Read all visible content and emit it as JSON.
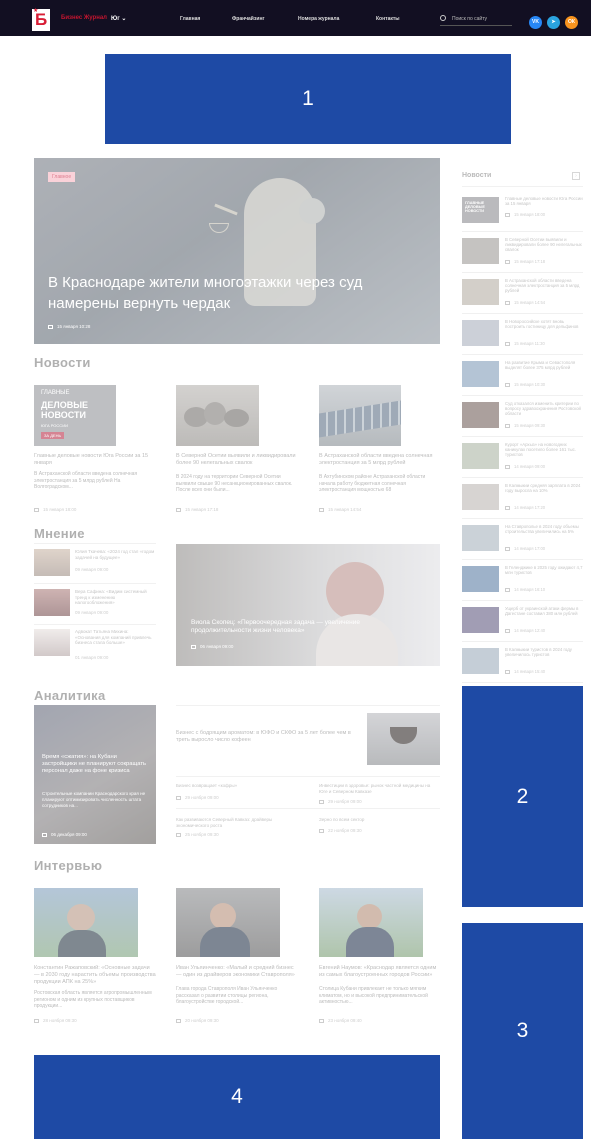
{
  "header": {
    "logo_letter": "Б",
    "brand": "Бизнес Журнал",
    "region": "Юг",
    "nav": [
      "Главная",
      "Франчайзинг",
      "Номера журнала",
      "Контакты"
    ],
    "search_placeholder": "Поиск по сайту",
    "social": [
      "vk-icon",
      "telegram-icon",
      "odnoklassniki-icon"
    ]
  },
  "ads": [
    "1",
    "2",
    "3",
    "4"
  ],
  "hero": {
    "tag": "Главное",
    "title": "В Краснодаре жители многоэтажки через суд намерены вернуть чердак",
    "date": "15 января 10:28"
  },
  "news": {
    "title": "Новости",
    "items": [
      {
        "title": "Главные деловые новости Юга России за 15 января",
        "text": "В Астраханской области введена солнечная электростанция за 5 млрд рублей На Волгоградском...",
        "date": "15 января 18:00",
        "image": {
          "line1": "ГЛАВНЫЕ",
          "line2": "ДЕЛОВЫЕ",
          "line3": "НОВОСТИ",
          "line4": "ЮГА РОССИИ",
          "line5": "ЗА ДЕНЬ"
        }
      },
      {
        "title": "В Северной Осетии выявили и ликвидировали более 90 нелегальных свалок",
        "text": "В 2024 году на территории Северной Осетии выявили свыше 90 несанкционированных свалок. После всех они были...",
        "date": "15 января 17:18"
      },
      {
        "title": "В Астраханской области введена солнечная электростанция за 5 млрд рублей",
        "text": "В Ахтубинском районе Астраханской области начала работу бюджетная солнечная электростанция мощностью 68",
        "date": "15 января 14:54"
      }
    ]
  },
  "opinion": {
    "title": "Мнение",
    "items": [
      {
        "text": "Юлия Ткачева: «2024 год стал «годом задачей на будущее»",
        "date": "09 января 09:00"
      },
      {
        "text": "Вера Сафина: «Видим системный тренд к изменению налогообложения»",
        "date": "09 января 09:00"
      },
      {
        "text": "Адвокат Татьяна Михина: «Основания для компаний привлечь бизнеса стала больше»",
        "date": "01 января 09:00"
      }
    ],
    "feature": {
      "title": "Виола Скопец: «Первоочередная задача — увеличение продолжительности жизни человека»",
      "date": "06 января 09:00"
    }
  },
  "analytics": {
    "title": "Аналитика",
    "feature": {
      "title": "Время «сжатия»: на Кубани застройщики не планируют сокращать персонал даже на фоне кризиса",
      "text": "Строительные компании Краснодарского края не планируют оптимизировать численность штата сотрудников на...",
      "date": "06 декабря 09:00"
    },
    "main": {
      "title": "Бизнес с бодрящим ароматом: в ЮФО и СКФО за 5 лет более чем в треть выросло число кофеен"
    },
    "items": [
      {
        "title": "Бизнес возвращает «кофры»",
        "date": "29 ноября 09:00"
      },
      {
        "title": "Инвестиции в здоровье: рынок частной медицины на Юге и Северном Кавказе",
        "date": "29 ноября 09:00"
      },
      {
        "title": "Как развиваются Северный Кавказ: драйверы экономического роста",
        "date": "25 ноября 09:30"
      },
      {
        "title": "Зерно по всем сектор",
        "date": "22 ноября 09:30"
      }
    ]
  },
  "interviews": {
    "title": "Интервью",
    "items": [
      {
        "title": "Константин Ражаповский: «Основные задачи — в 2030 году нарастить объемы производства продукции АПК на 25%»",
        "text": "Ростовская область является агропромышленным регионом и одним из крупных поставщиков продукции...",
        "date": "28 ноября 09:30"
      },
      {
        "title": "Иван Ульяинченко: «Малый и средний бизнес — один из драйверов экономики Ставрополя»",
        "text": "Глава города Ставрополя Иван Ульянченко рассказал о развитии столицы региона, благоустройстве городской...",
        "date": "20 ноября 09:30"
      },
      {
        "title": "Евгений Наумов: «Краснодар является одним из самых благоустроенных городов России»",
        "text": "Столица Кубани привлекает не только мягким климатом, но и высокой предпринимательской активностью...",
        "date": "23 ноября 09:40"
      }
    ]
  },
  "sidebar": {
    "title": "Новости",
    "items": [
      {
        "title": "Главные деловые новости Юга России за 15 января",
        "date": "15 января 18:00"
      },
      {
        "title": "В Северной Осетии выявили и ликвидировали более 90 нелегальных свалок",
        "date": "15 января 17:18"
      },
      {
        "title": "В Астраханской области введена солнечная электростанция за 5 млрд рублей",
        "date": "15 января 14:54"
      },
      {
        "title": "В Новороссийске хотят вновь построить гостиницу для дельфинов",
        "date": "15 января 11:30"
      },
      {
        "title": "На развитие Крыма и Севастополя выделят более 375 млрд рублей",
        "date": "15 января 10:30"
      },
      {
        "title": "Суд отказался изменить критерии по вопросу здравоохранения Ростовской области",
        "date": "15 января 09:30"
      },
      {
        "title": "Курорт «Архыз» на новогодних каникулах посетило более 161 тыс. туристов",
        "date": "14 января 09:00"
      },
      {
        "title": "В Калмыкии средняя зарплата в 2024 году выросла на 10%",
        "date": "14 января 17:20"
      },
      {
        "title": "На Ставрополье в 2024 году объемы строительства увеличились на 5%",
        "date": "14 января 17:00"
      },
      {
        "title": "В Геленджике в 2025 году ожидают 4,7 млн туристов",
        "date": "14 января 16:10"
      },
      {
        "title": "Ущерб от украинской атаки фермы в Дагестане составил 380 млн рублей",
        "date": "14 января 12:40"
      },
      {
        "title": "В Калмыкии туристов в 2024 году увеличилось туристов",
        "date": "14 января 15:40"
      }
    ]
  }
}
